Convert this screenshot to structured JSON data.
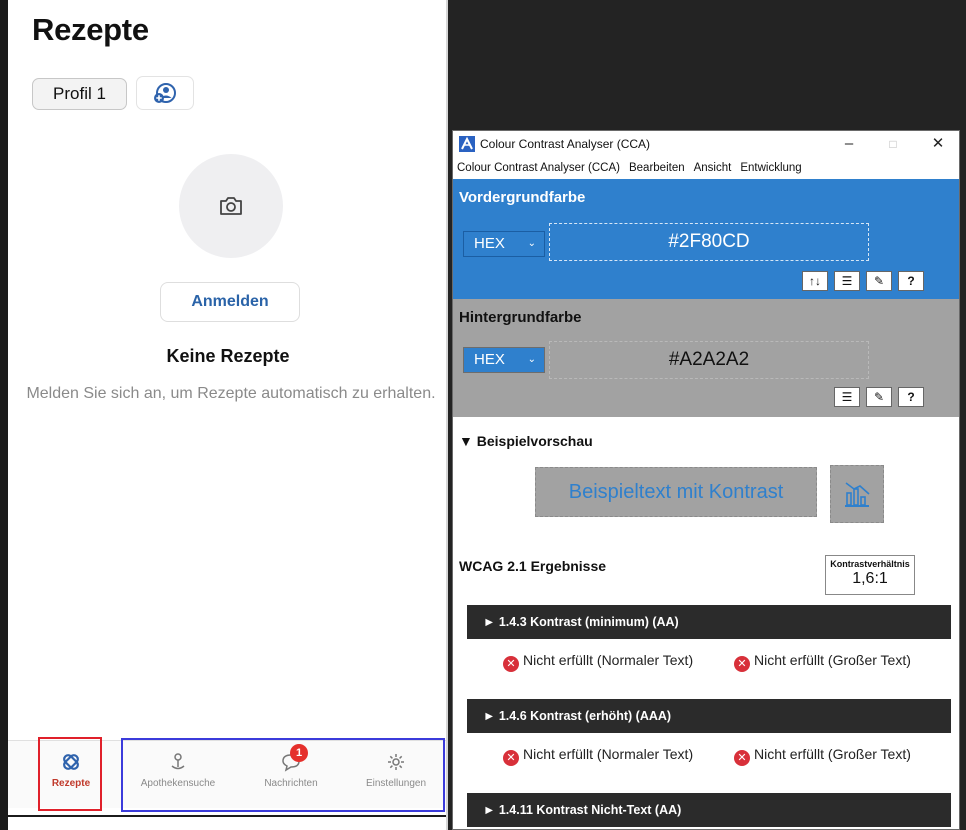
{
  "app": {
    "title": "Rezepte",
    "profile_chip": "Profil 1",
    "login_button": "Anmelden",
    "empty_title": "Keine Rezepte",
    "empty_subtitle": "Melden Sie sich an, um Rezepte automatisch zu erhalten.",
    "tabs": [
      {
        "label": "Rezepte",
        "icon": "pill-icon",
        "active": true
      },
      {
        "label": "Apothekensuche",
        "icon": "location-pin-icon",
        "active": false
      },
      {
        "label": "Nachrichten",
        "icon": "chat-bubble-icon",
        "active": false,
        "badge": "1"
      },
      {
        "label": "Einstellungen",
        "icon": "gear-icon",
        "active": false
      }
    ]
  },
  "cca": {
    "window_title": "Colour Contrast Analyser (CCA)",
    "window_controls": {
      "minimize": "–",
      "maximize": "□",
      "close": "✕"
    },
    "menu": [
      "Colour Contrast Analyser (CCA)",
      "Bearbeiten",
      "Ansicht",
      "Entwicklung"
    ],
    "foreground": {
      "title": "Vordergrundfarbe",
      "format": "HEX",
      "value": "#2F80CD",
      "buttons": [
        "↑↓",
        "☰",
        "✎",
        "?"
      ]
    },
    "background": {
      "title": "Hintergrundfarbe",
      "format": "HEX",
      "value": "#A2A2A2",
      "buttons": [
        "☰",
        "✎",
        "?"
      ]
    },
    "preview": {
      "heading": "▼ Beispielvorschau",
      "sample_text": "Beispieltext mit Kontrast"
    },
    "wcag": {
      "heading": "WCAG 2.1 Ergebnisse",
      "ratio_label": "Kontrastverhältnis",
      "ratio_value": "1,6:1",
      "criteria": [
        {
          "title": "► 1.4.3 Kontrast (minimum) (AA)",
          "normal": "Nicht erfüllt (Normaler Text)",
          "large": "Nicht erfüllt (Großer Text)"
        },
        {
          "title": "► 1.4.6 Kontrast (erhöht) (AAA)",
          "normal": "Nicht erfüllt (Normaler Text)",
          "large": "Nicht erfüllt (Großer Text)"
        },
        {
          "title": "► 1.4.11 Kontrast Nicht-Text (AA)"
        }
      ]
    }
  },
  "colors": {
    "foreground": "#2F80CD",
    "background": "#A2A2A2",
    "fail": "#d8303a",
    "active_tab_highlight": "#e0202a",
    "inactive_tabs_highlight": "#3b3bdb"
  }
}
